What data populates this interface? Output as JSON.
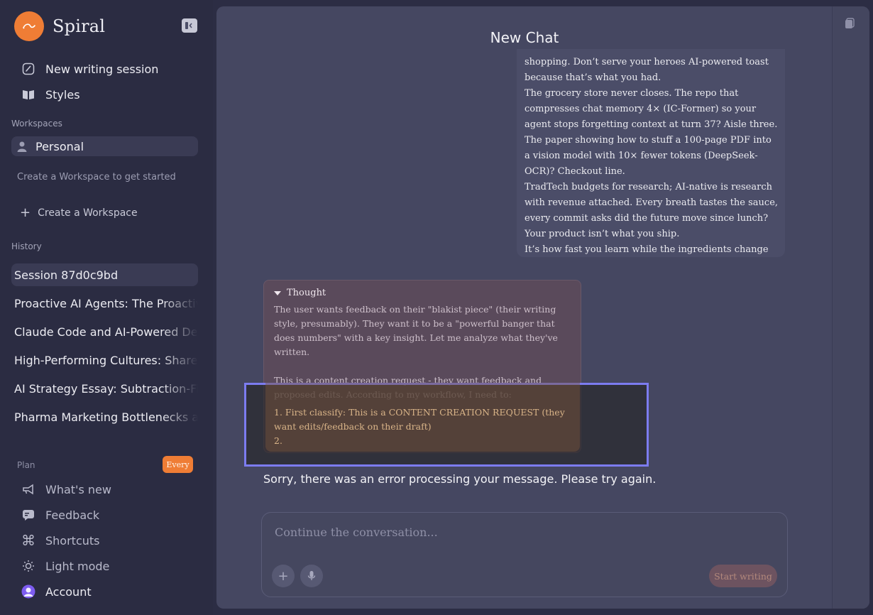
{
  "sidebar": {
    "brand": "Spiral",
    "nav": [
      {
        "label": "New writing session",
        "icon": "compose-icon"
      },
      {
        "label": "Styles",
        "icon": "book-icon"
      }
    ],
    "workspaces_label": "Workspaces",
    "workspace": "Personal",
    "workspace_hint": "Create a Workspace to get started",
    "create_workspace": "Create a Workspace",
    "history_label": "History",
    "history": [
      "Session 87d0c9bd",
      "Proactive AI Agents: The Proactive",
      "Claude Code and AI-Powered Development",
      "High-Performing Cultures: Shared",
      "AI Strategy Essay: Subtraction-First",
      "Pharma Marketing Bottlenecks and"
    ],
    "plan_label": "Plan",
    "plan_badge": "Every",
    "footer": [
      {
        "label": "What's new",
        "icon": "megaphone-icon"
      },
      {
        "label": "Feedback",
        "icon": "chat-bubble-icon"
      },
      {
        "label": "Shortcuts",
        "icon": "command-icon"
      },
      {
        "label": "Light mode",
        "icon": "sun-icon"
      },
      {
        "label": "Account",
        "icon": "avatar-icon"
      }
    ]
  },
  "main": {
    "title": "New Chat",
    "user_message": [
      "shopping. Don’t serve your heroes AI-powered toast because that’s what you had.",
      "The grocery store never closes. The repo that compresses chat memory 4× (IC-Former) so your agent stops forgetting context at turn 37? Aisle three. The paper showing how to stuff a 100-page PDF into a vision model with 10× fewer tokens (DeepSeek-OCR)? Checkout line.",
      "TradTech budgets for research; AI-native is research with revenue attached. Every breath tastes the sauce, every commit asks did the future move since lunch?",
      "Your product isn’t what you ship.",
      "It’s how fast you learn while the ingredients change under your fingernails."
    ],
    "thought": {
      "label": "Thought",
      "text": "The user wants feedback on their \"blakist piece\" (their writing style, presumably). They want it to be a \"powerful banger that does numbers\" with a key insight. Let me analyze what they've written.\n\nThis is a content creation request - they want feedback and proposed edits. According to my workflow, I need to:",
      "highlight": "1. First classify: This is a CONTENT CREATION REQUEST (they want edits/feedback on their draft)\n2."
    },
    "error": "Sorry, there was an error processing your message. Please try again.",
    "composer": {
      "placeholder": "Continue the conversation...",
      "start_label": "Start writing"
    }
  },
  "colors": {
    "accent": "#ef7d35",
    "highlight_border": "#7c7cf0"
  }
}
